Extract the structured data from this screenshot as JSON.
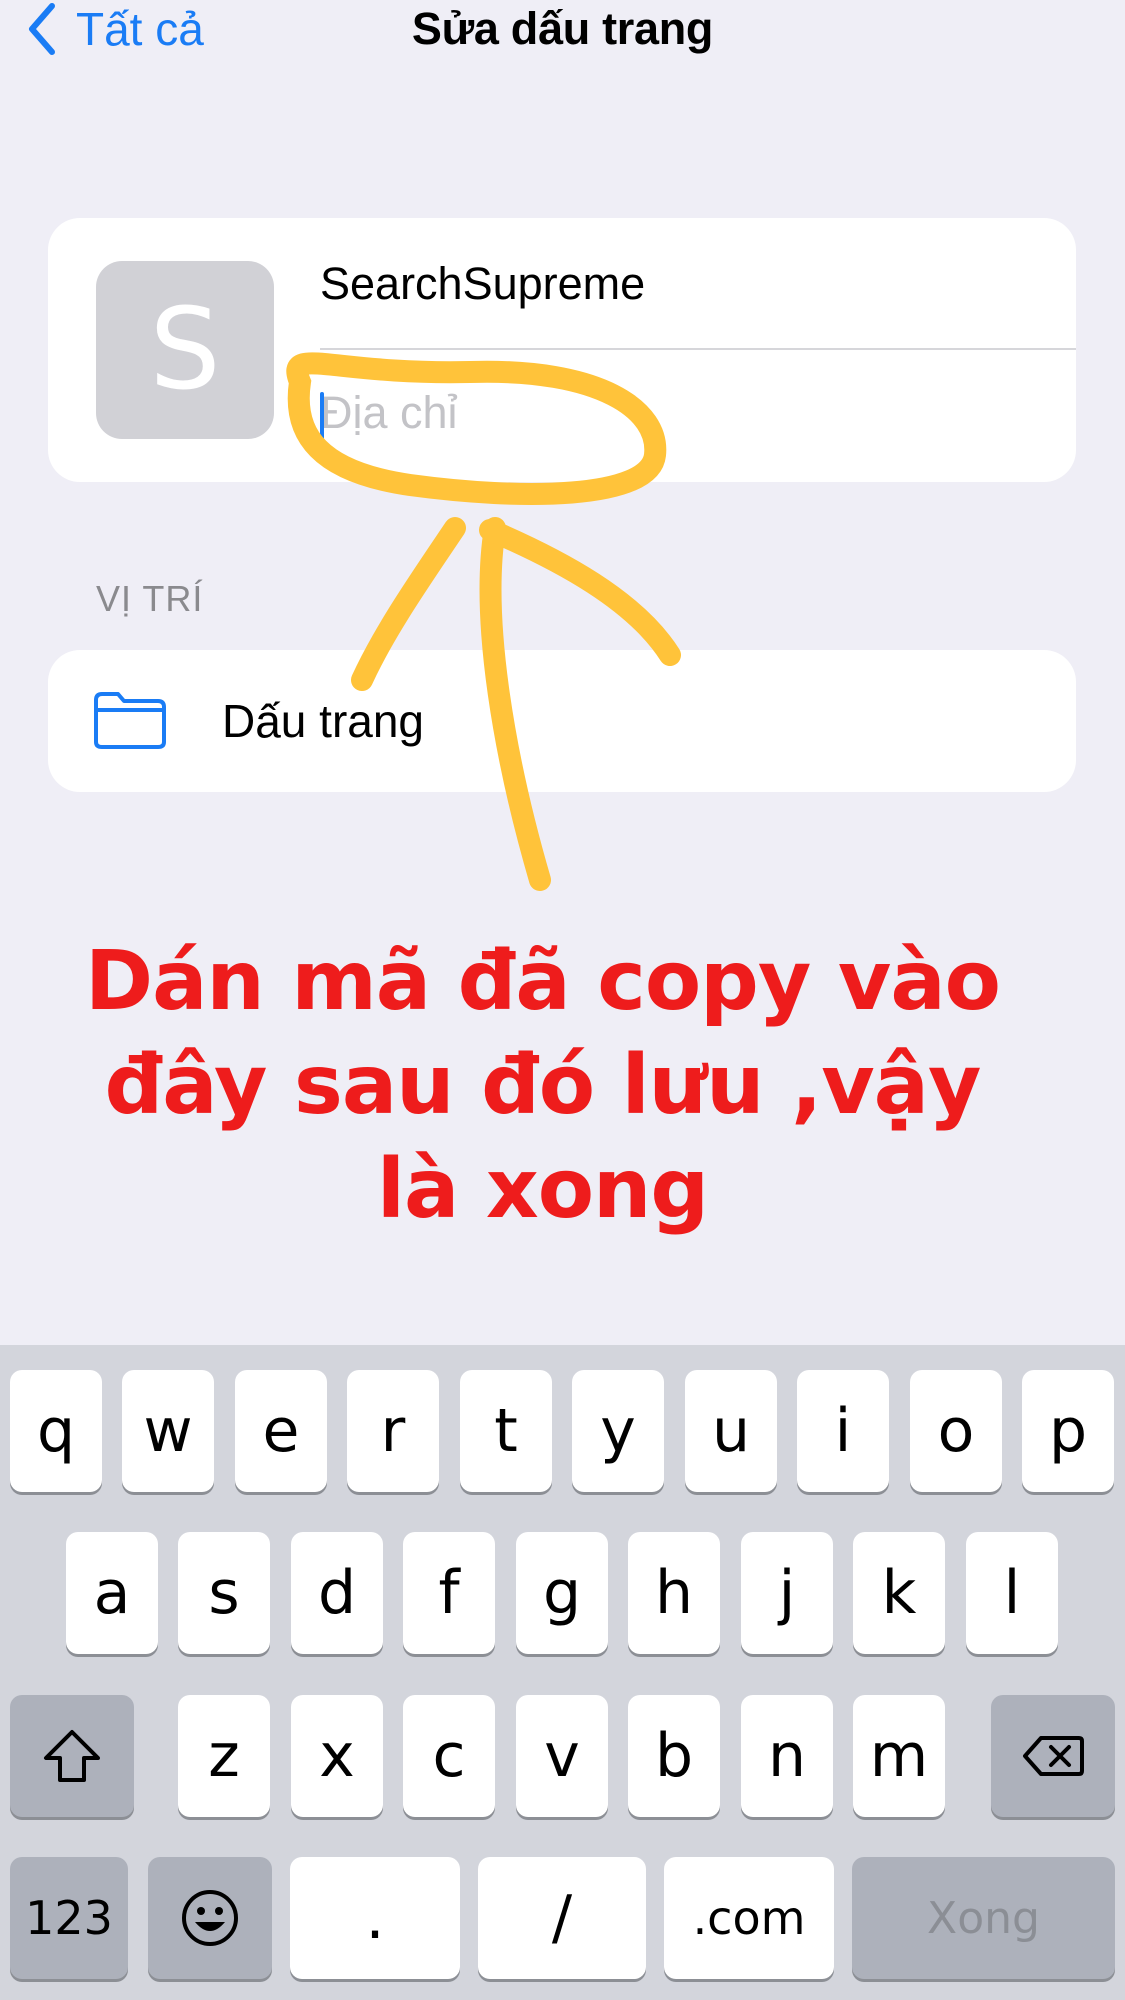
{
  "nav": {
    "back_label": "Tất cả",
    "title": "Sửa dấu trang"
  },
  "bookmark": {
    "favicon_letter": "S",
    "title_value": "SearchSupreme",
    "address_value": "",
    "address_placeholder": "Địa chỉ"
  },
  "location": {
    "section_header": "VỊ TRÍ",
    "folder_label": "Dấu trang"
  },
  "annotation": {
    "text": "Dán mã đã copy vào đây sau đó lưu ,vậy là xong",
    "color": "#ee1c1c",
    "marker_color": "#ffc33a"
  },
  "keyboard": {
    "row1": [
      "q",
      "w",
      "e",
      "r",
      "t",
      "y",
      "u",
      "i",
      "o",
      "p"
    ],
    "row2": [
      "a",
      "s",
      "d",
      "f",
      "g",
      "h",
      "j",
      "k",
      "l"
    ],
    "row3": [
      "z",
      "x",
      "c",
      "v",
      "b",
      "n",
      "m"
    ],
    "shift_icon": "shift-icon",
    "delete_icon": "delete-icon",
    "numbers_label": "123",
    "emoji_icon": "emoji-icon",
    "dot_label": ".",
    "slash_label": "/",
    "dotcom_label": ".com",
    "done_label": "Xong"
  },
  "colors": {
    "accent": "#1a7cf5",
    "background": "#efeef6"
  }
}
